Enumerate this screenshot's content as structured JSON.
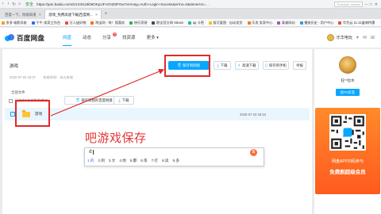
{
  "browser": {
    "lock_text": "安全",
    "url": "https://pan.baidu.com/s/1X3S18i06OKpUFcGNZ0FOw?errmsg=Auth+Login+Sucess&errno=0&ssnerror=...",
    "search_placeholder": "Translate answer",
    "tabs": [
      {
        "label": "百度一下，你就知道",
        "active": false
      },
      {
        "label": "游戏_免费高速下载|百度网...",
        "active": true
      }
    ],
    "bookmarks": [
      "多多 电影导航",
      "千牛·卖家工作台",
      "万人迷好物",
      "淘宝网 - 淘！我喜欢",
      "快乐资源",
      "欧宝官方网 Steam",
      "qq 卡密",
      "饭可爱图 · 自动发货",
      "乐发 卖家中心",
      "泰美网站",
      "播放历史 - 用户中心",
      "华为云 11.11盛典特惠"
    ]
  },
  "header": {
    "logo_text": "百度网盘",
    "nav": [
      {
        "label": "网盘",
        "active": true,
        "badge": ""
      },
      {
        "label": "动态",
        "active": false,
        "badge": ""
      },
      {
        "label": "分享",
        "active": false,
        "badge": "9"
      },
      {
        "label": "找资源",
        "active": false,
        "badge": ""
      },
      {
        "label": "更多",
        "active": false,
        "badge": ""
      }
    ],
    "user_name": "乐华电玩"
  },
  "share": {
    "title": "游戏",
    "created": "2020-07-20 18:37",
    "expiry": "失效时间：永久有效",
    "buttons": {
      "save": "保存到网盘",
      "download": "下载",
      "fast_download": "高速下载",
      "save_phone": "保存到手机",
      "report": "举报"
    },
    "all_files_label": "全部文件",
    "selected_info": "已选中1个文件/文件夹",
    "list_save": "保存到我的百度网盘",
    "list_download": "下载",
    "files": [
      {
        "name": "游戏",
        "date": "2020-07-20 18:34",
        "checked": true
      }
    ]
  },
  "ime": {
    "typed_text": "吧游戏保存",
    "composition": "d",
    "candidates": [
      "1.的",
      "2.到",
      "3.大",
      "4.地",
      "5.都",
      "6.等",
      "7.打",
      "8.读",
      "9.多"
    ]
  },
  "sidebar": {
    "user": "狂**拉水",
    "follow_label": "加TA好友",
    "promo_line1": "网盘APP扫码参与",
    "promo_line2": "免费剧超级会员"
  },
  "colors": {
    "accent": "#06a7ff",
    "annotation_red": "#e22a2a",
    "promo_orange": "#ff6a24"
  }
}
